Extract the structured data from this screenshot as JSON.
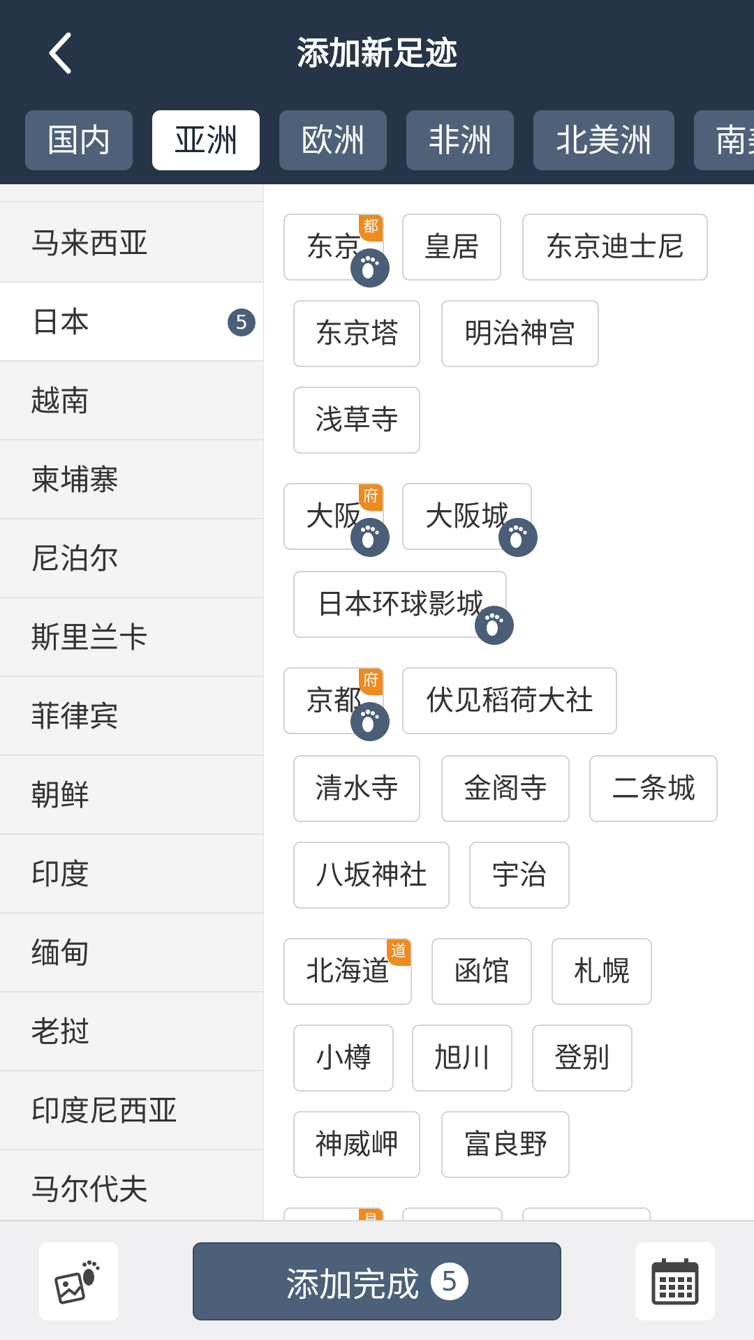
{
  "header": {
    "title": "添加新足迹",
    "back_icon": "chevron-left-icon"
  },
  "tabs": [
    "国内",
    "亚洲",
    "欧洲",
    "非洲",
    "北美洲",
    "南美洲"
  ],
  "active_tab": "亚洲",
  "countries": [
    {
      "name": "马来西亚"
    },
    {
      "name": "日本",
      "badge": "5",
      "active": true
    },
    {
      "name": "越南"
    },
    {
      "name": "柬埔寨"
    },
    {
      "name": "尼泊尔"
    },
    {
      "name": "斯里兰卡"
    },
    {
      "name": "菲律宾"
    },
    {
      "name": "朝鲜"
    },
    {
      "name": "印度"
    },
    {
      "name": "缅甸"
    },
    {
      "name": "老挝"
    },
    {
      "name": "印度尼西亚"
    },
    {
      "name": "马尔代夫"
    }
  ],
  "spots": {
    "tokyo": {
      "label": "东京",
      "tag": "都",
      "visited": true
    },
    "imperial_palace": {
      "label": "皇居",
      "visited": false
    },
    "tokyo_disney": {
      "label": "东京迪士尼",
      "visited": false
    },
    "tokyo_tower": {
      "label": "东京塔",
      "visited": false
    },
    "meiji_jingu": {
      "label": "明治神宫",
      "visited": false
    },
    "sensoji": {
      "label": "浅草寺",
      "visited": false
    },
    "osaka": {
      "label": "大阪",
      "tag": "府",
      "visited": true
    },
    "osaka_castle": {
      "label": "大阪城",
      "visited": true
    },
    "usj": {
      "label": "日本环球影城",
      "visited": true
    },
    "kyoto": {
      "label": "京都",
      "tag": "府",
      "visited": true
    },
    "fushimi_inari": {
      "label": "伏见稻荷大社",
      "visited": false
    },
    "kiyomizu": {
      "label": "清水寺",
      "visited": false
    },
    "kinkakuji": {
      "label": "金阁寺",
      "visited": false
    },
    "nijo": {
      "label": "二条城",
      "visited": false
    },
    "yasaka": {
      "label": "八坂神社",
      "visited": false
    },
    "uji": {
      "label": "宇治",
      "visited": false
    },
    "hokkaido": {
      "label": "北海道",
      "tag": "道",
      "visited": false
    },
    "hakodate": {
      "label": "函馆",
      "visited": false
    },
    "sapporo": {
      "label": "札幌",
      "visited": false
    },
    "otaru": {
      "label": "小樽",
      "visited": false
    },
    "asahikawa": {
      "label": "旭川",
      "visited": false
    },
    "noboribetsu": {
      "label": "登别",
      "visited": false
    },
    "kamuimisaki": {
      "label": "神威岬",
      "visited": false
    },
    "furano": {
      "label": "富良野",
      "visited": false
    },
    "next_pref": {
      "label": "",
      "tag": "县",
      "visited": false
    },
    "next_a": {
      "label": "",
      "visited": false
    },
    "next_b": {
      "label": "",
      "visited": false
    }
  },
  "bottom_bar": {
    "photo_icon": "photo-footprint-icon",
    "done_label": "添加完成",
    "done_count": "5",
    "calendar_icon": "calendar-icon"
  },
  "colors": {
    "header_bg": "#263447",
    "tab_bg": "#4f6179",
    "accent": "#4c6079",
    "tag_orange": "#ef8a1e"
  }
}
